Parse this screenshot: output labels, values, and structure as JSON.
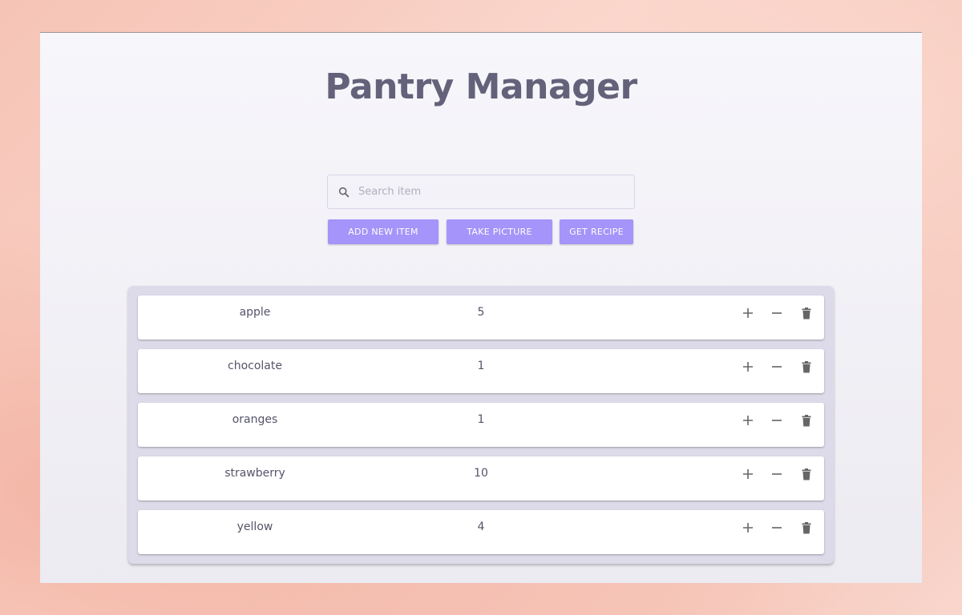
{
  "app": {
    "title": "Pantry Manager"
  },
  "search": {
    "placeholder": "Search item",
    "value": "",
    "icon": "search-icon"
  },
  "actions": {
    "add_label": "ADD NEW ITEM",
    "picture_label": "TAKE PICTURE",
    "recipe_label": "GET RECIPE"
  },
  "colors": {
    "accent": "#a594f9",
    "title": "#63627a",
    "list_bg": "#dddbea"
  },
  "pantry": {
    "items": [
      {
        "name": "apple",
        "quantity": "5"
      },
      {
        "name": "chocolate",
        "quantity": "1"
      },
      {
        "name": "oranges",
        "quantity": "1"
      },
      {
        "name": "strawberry",
        "quantity": "10"
      },
      {
        "name": "yellow",
        "quantity": "4"
      }
    ],
    "row_icons": [
      "plus-icon",
      "minus-icon",
      "trash-icon"
    ]
  }
}
